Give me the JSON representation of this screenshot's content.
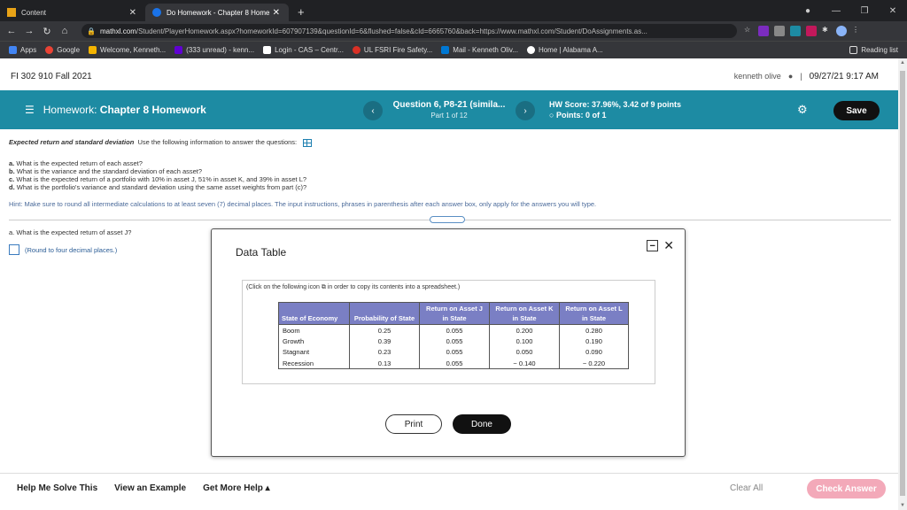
{
  "browser": {
    "tabs": [
      {
        "label": "Content",
        "active": false
      },
      {
        "label": "Do Homework - Chapter 8 Home",
        "active": true
      }
    ],
    "url_host": "mathxl.com",
    "url_path": "/Student/PlayerHomework.aspx?homeworkId=607907139&questionId=6&flushed=false&cId=6665760&back=https://www.mathxl.com/Student/DoAssignments.as...",
    "bookmarks": [
      {
        "label": "Apps",
        "color": "#4285f4"
      },
      {
        "label": "Google",
        "color": "#ea4335"
      },
      {
        "label": "Welcome, Kenneth...",
        "color": "#f4b400"
      },
      {
        "label": "(333 unread) - kenn...",
        "color": "#6001d2"
      },
      {
        "label": "Login - CAS – Centr...",
        "color": "#ffffff"
      },
      {
        "label": "UL FSRI Fire Safety...",
        "color": "#d93025"
      },
      {
        "label": "Mail - Kenneth Oliv...",
        "color": "#0078d4"
      },
      {
        "label": "Home | Alabama A...",
        "color": "#ffffff"
      }
    ],
    "reading_list": "Reading list"
  },
  "course": {
    "name": "FI 302 910 Fall 2021",
    "user": "kenneth olive",
    "datetime": "09/27/21 9:17 AM"
  },
  "hwbar": {
    "prefix": "Homework:",
    "title": "Chapter 8 Homework",
    "question": "Question 6, P8-21 (simila...",
    "part": "Part 1 of 12",
    "score": "HW Score: 37.96%, 3.42 of 9 points",
    "points": "Points: 0 of 1",
    "save": "Save"
  },
  "problem": {
    "heading_title": "Expected return and standard deviation",
    "heading_text": "Use the following information to answer the questions:",
    "questions": [
      {
        "letter": "a.",
        "text": "What is the expected return of each asset?"
      },
      {
        "letter": "b.",
        "text": "What is the variance and the standard deviation of each asset?"
      },
      {
        "letter": "c.",
        "text": "What is the expected return of a portfolio with 10% in asset J, 51% in asset K, and 39% in asset L?"
      },
      {
        "letter": "d.",
        "text": "What is the portfolio's variance and standard deviation using the same asset weights from part (c)?"
      }
    ],
    "hint": "Hint: Make sure to round all intermediate calculations to at least seven (7) decimal places. The input instructions, phrases in parenthesis after each answer box, only apply for the answers you will type.",
    "part_a": "a. What is the expected return of asset J?",
    "answer_hint": "(Round to four decimal places.)"
  },
  "dialog": {
    "title": "Data Table",
    "copy_note": "(Click on the following icon",
    "copy_note_rest": "in order to copy its contents into a spreadsheet.)",
    "columns": [
      "State of Economy",
      "Probability of State",
      "Return on Asset J in State",
      "Return on Asset K in State",
      "Return on Asset L in State"
    ],
    "rows": [
      [
        "Boom",
        "0.25",
        "0.055",
        "0.200",
        "0.280"
      ],
      [
        "Growth",
        "0.39",
        "0.055",
        "0.100",
        "0.190"
      ],
      [
        "Stagnant",
        "0.23",
        "0.055",
        "0.050",
        "0.090"
      ],
      [
        "Recession",
        "0.13",
        "0.055",
        "− 0.140",
        "− 0.220"
      ]
    ],
    "print": "Print",
    "done": "Done"
  },
  "footer": {
    "help_solve": "Help Me Solve This",
    "view_example": "View an Example",
    "more_help": "Get More Help ▴",
    "clear_all": "Clear All",
    "check_answer": "Check Answer"
  }
}
